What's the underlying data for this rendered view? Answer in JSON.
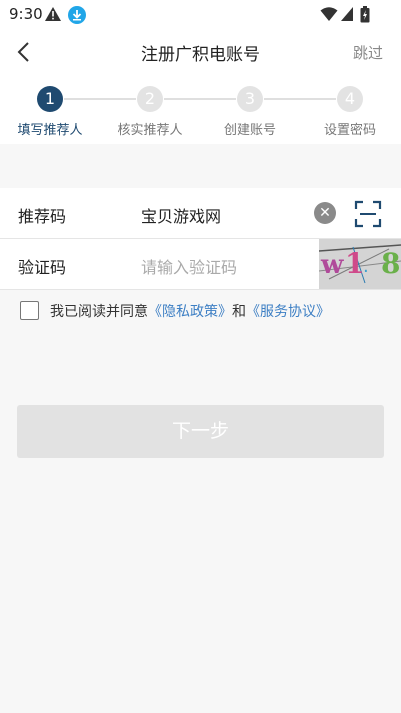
{
  "status_bar": {
    "time": "9:30"
  },
  "header": {
    "title": "注册广积电账号",
    "skip_label": "跳过"
  },
  "steps": [
    {
      "num": "1",
      "label": "填写推荐人"
    },
    {
      "num": "2",
      "label": "核实推荐人"
    },
    {
      "num": "3",
      "label": "创建账号"
    },
    {
      "num": "4",
      "label": "设置密码"
    }
  ],
  "form": {
    "referral": {
      "label": "推荐码",
      "value": "宝贝游戏网"
    },
    "verify": {
      "label": "验证码",
      "placeholder": "请输入验证码",
      "captcha_text": "w1·8"
    }
  },
  "agreement": {
    "prefix": "我已阅读并同意",
    "privacy_link": "《隐私政策》",
    "conjunction": "和",
    "service_link": "《服务协议》"
  },
  "next_button": {
    "label": "下一步"
  },
  "colors": {
    "accent": "#1f4a70",
    "link": "#3d7fc4",
    "disabled_button": "#e2e2e2"
  }
}
